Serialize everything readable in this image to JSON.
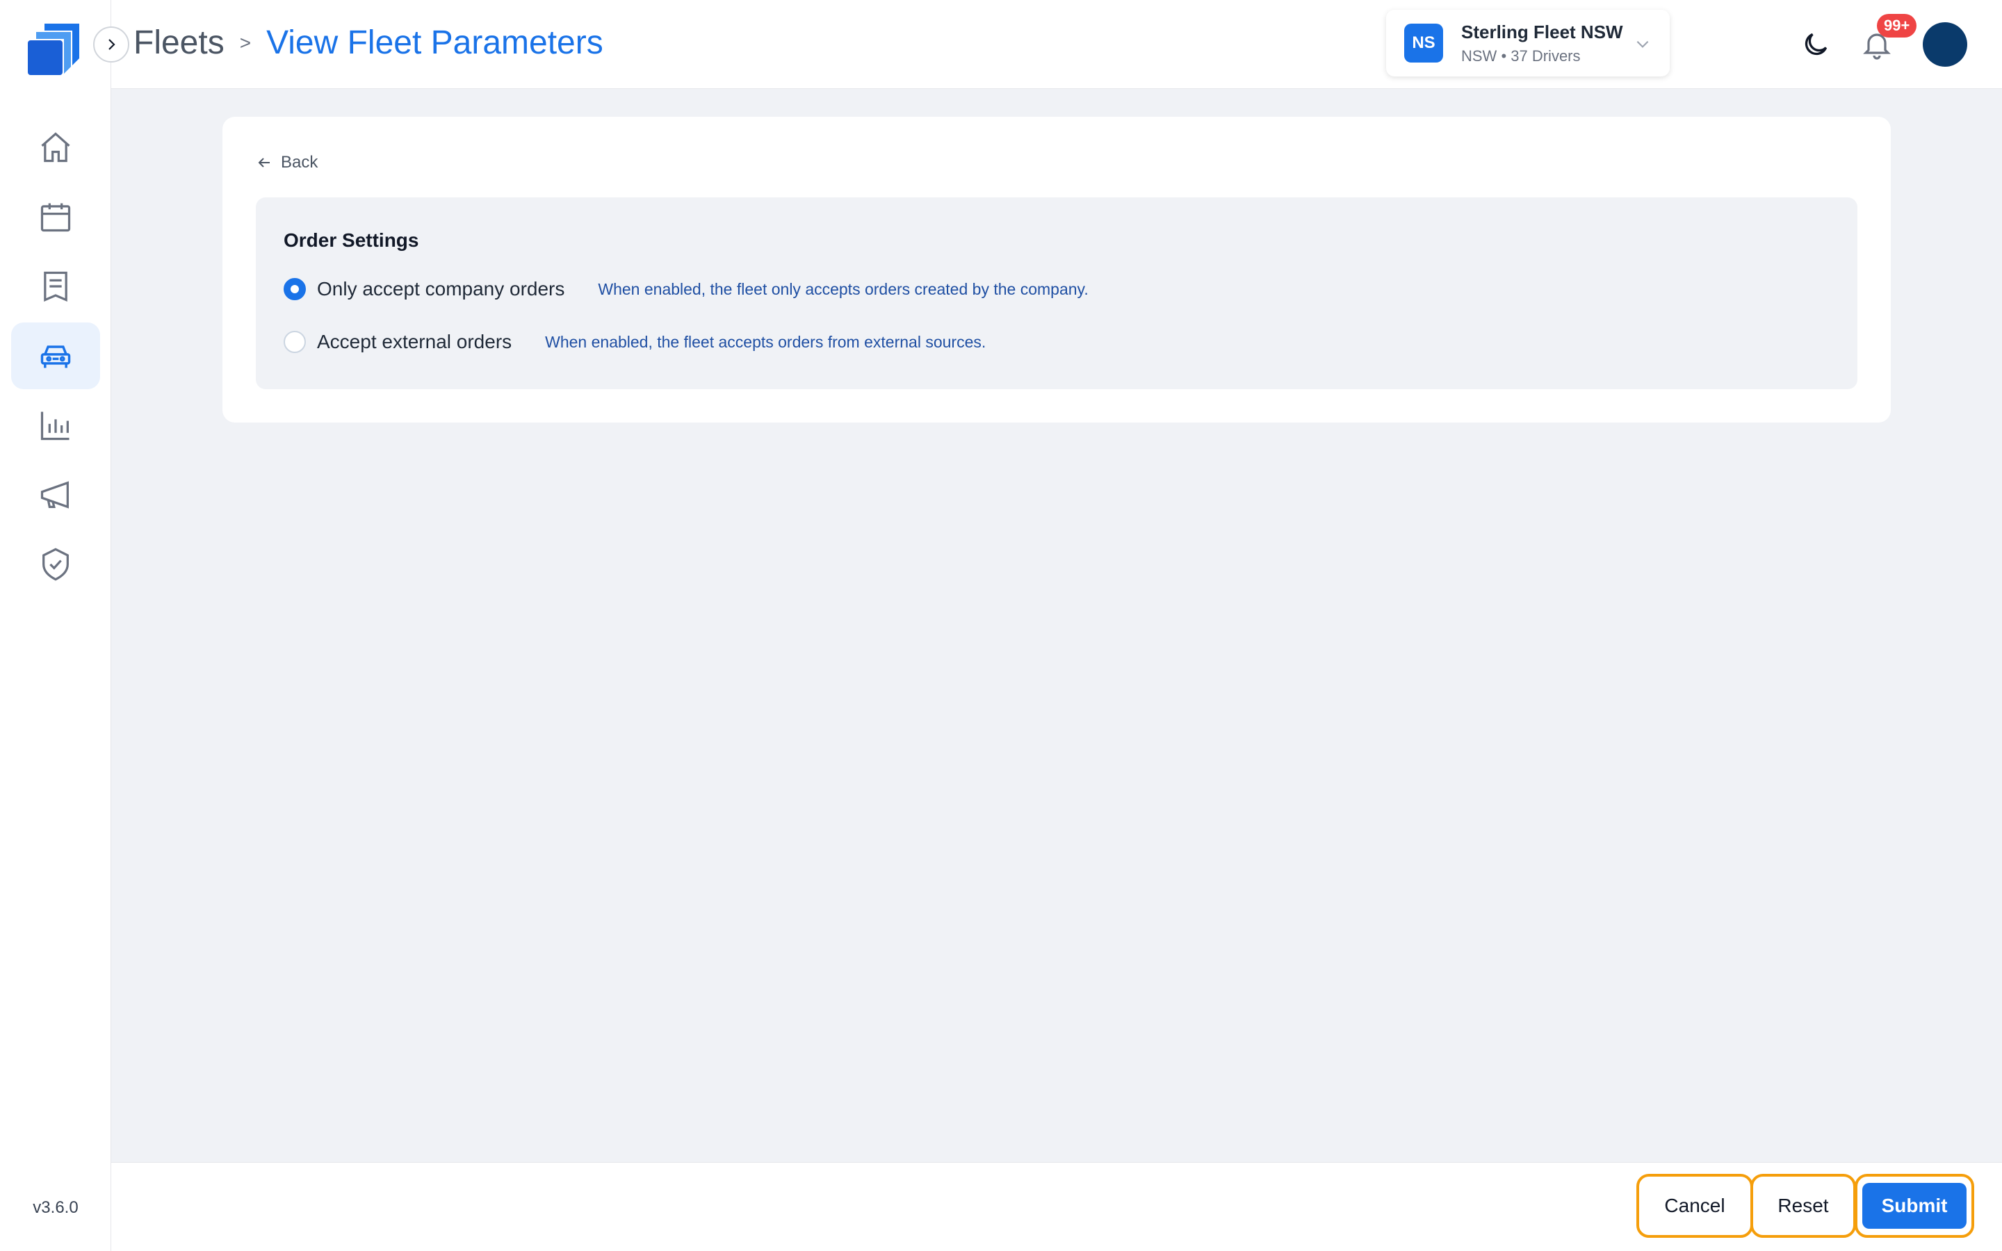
{
  "app": {
    "version": "v3.6.0"
  },
  "breadcrumb": {
    "root": "Fleets",
    "separator": ">",
    "current": "View Fleet Parameters"
  },
  "fleet_switcher": {
    "badge": "NS",
    "name": "Sterling Fleet NSW",
    "meta": "NSW • 37 Drivers"
  },
  "notifications": {
    "count": "99+"
  },
  "sidebar": {
    "items": [
      {
        "icon": "home-icon",
        "active": false
      },
      {
        "icon": "calendar-icon",
        "active": false
      },
      {
        "icon": "orders-icon",
        "active": false
      },
      {
        "icon": "fleet-car-icon",
        "active": true
      },
      {
        "icon": "analytics-icon",
        "active": false
      },
      {
        "icon": "megaphone-icon",
        "active": false
      },
      {
        "icon": "shield-check-icon",
        "active": false
      }
    ]
  },
  "card": {
    "back_label": "Back",
    "panel_title": "Order Settings",
    "options": [
      {
        "label": "Only accept company orders",
        "help": "When enabled, the fleet only accepts orders created by the company.",
        "selected": true
      },
      {
        "label": "Accept external orders",
        "help": "When enabled, the fleet accepts orders from external sources.",
        "selected": false
      }
    ]
  },
  "footer": {
    "cancel_label": "Cancel",
    "reset_label": "Reset",
    "submit_label": "Submit"
  },
  "colors": {
    "accent": "#1a73e8",
    "highlight": "#f59e0b",
    "badge": "#ef4444",
    "avatar": "#0a3a6b"
  }
}
